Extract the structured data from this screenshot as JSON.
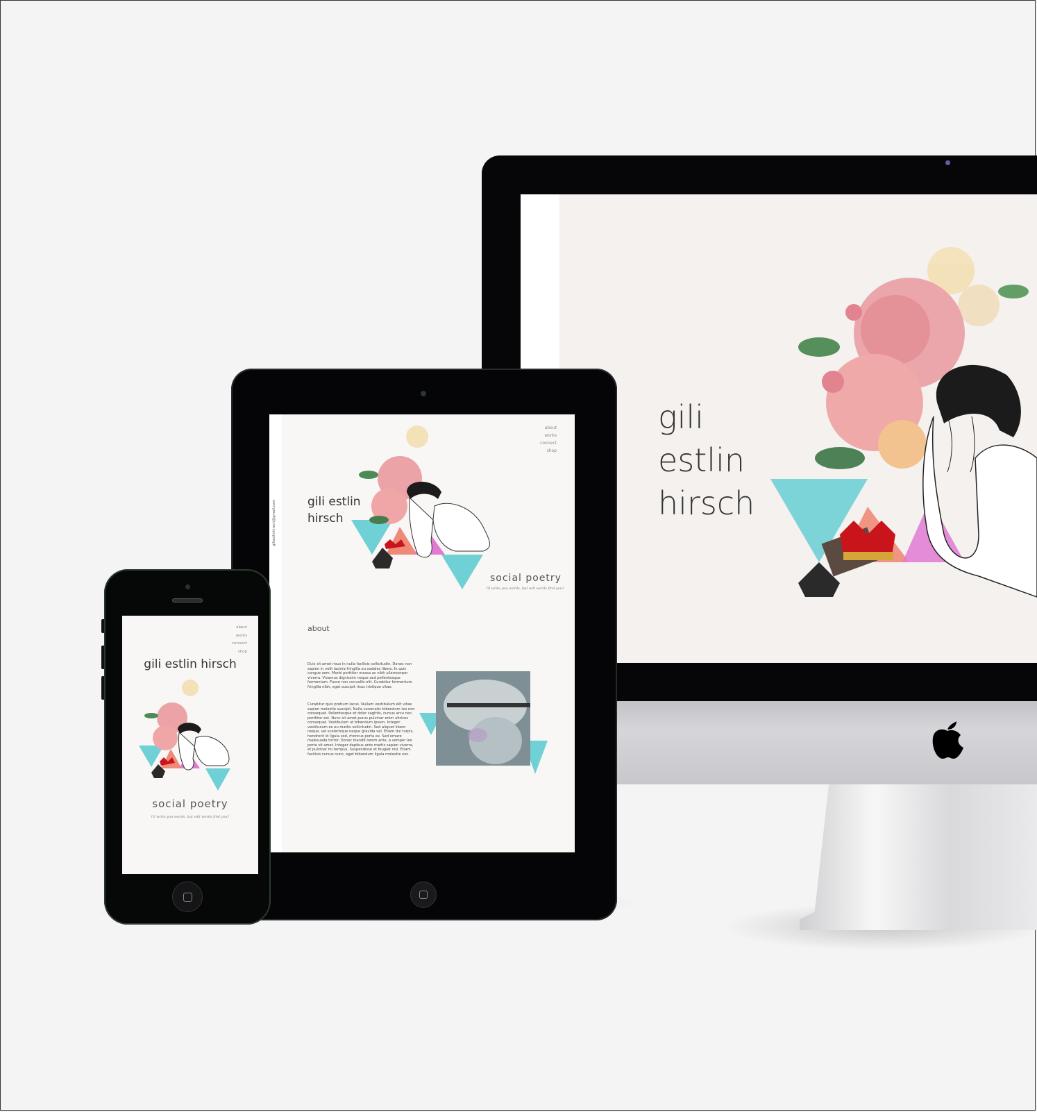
{
  "imac": {
    "title_line1": "gili estlin",
    "title_line2": "hirsch"
  },
  "ipad": {
    "nav": [
      "about",
      "works",
      "connect",
      "shop"
    ],
    "title_line1": "gili estlin",
    "title_line2": "hirsch",
    "side_text": "giliestlinhirsch@gmail.com",
    "tagline_main": "social poetry",
    "tagline_sub": "i'll write you words, but will words find you?",
    "about_heading": "about",
    "about_para1": "Duis sit amet risus in nulla facilisis sollicitudin. Donec non sapien in velit lacinia fringilla eu sodales libero. In quis congue sem. Morbi porttitor massa ac nibh ullamcorper viverra. Vivamus dignissim neque sed pellentesque fermentum. Fusce non convallis elit. Curabitur fermentum fringilla nibh, eget suscipit risus tristique vitae.",
    "about_para2": "Curabitur quis pretium lacus. Nullam vestibulum elit vitae sapien molestie suscipit. Nulla venenatis bibendum leo non consequat. Pellentesque et dolor sagittis, cursus arcu nec, porttitor est. Nunc sit amet purus pulvinar enim ultrices consequat. Vestibulum ut bibendum ipsum. Integer vestibulum ex eu mattis sollicitudin. Sed aliquet libero neque, vel scelerisque neque gravida vel. Etiam dui turpis, hendrerit id ligula sed, rhoncus porta ex. Sed ornare malesuada tortor. Donec blandit lorem ante, a semper leo porta sit amet. Integer dapibus ante mattis sapien viverra, et pulvinar mi tempus. Suspendisse et feugiat nisl. Etiam facilisis cursus nunc, eget bibendum ligula molestie nec."
  },
  "iphone": {
    "nav": [
      "about",
      "works",
      "connect",
      "shop"
    ],
    "title": "gili estlin hirsch",
    "tagline_main": "social poetry",
    "tagline_sub": "i'll write you words, but will words find you?"
  },
  "colors": {
    "background": "#f4f4f4",
    "device_black": "#060608",
    "screen_bg": "#f4f1ee",
    "accent_teal": "#6fd0d6",
    "accent_coral": "#f08a78",
    "accent_magenta": "#e07ad2",
    "accent_pink": "#eba3a8"
  },
  "icons": [
    "apple-logo-icon",
    "camera-dot-icon",
    "home-button-icon"
  ]
}
